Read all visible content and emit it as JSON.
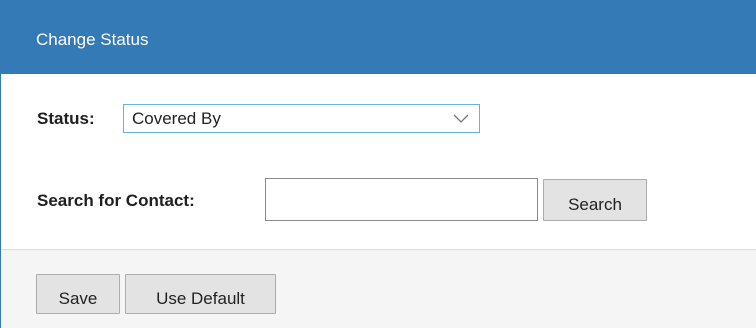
{
  "dialog": {
    "title": "Change Status"
  },
  "form": {
    "status_label": "Status:",
    "status_value": "Covered By",
    "contact_label": "Search for Contact:",
    "contact_value": "",
    "search_label": "Search"
  },
  "footer": {
    "save_label": "Save",
    "default_label": "Use Default"
  },
  "colors": {
    "header_bg": "#337ab7",
    "footer_bg": "#f5f5f5",
    "select_focus_border": "#66afe9"
  },
  "icons": {
    "dropdown": "chevron-down-icon"
  }
}
